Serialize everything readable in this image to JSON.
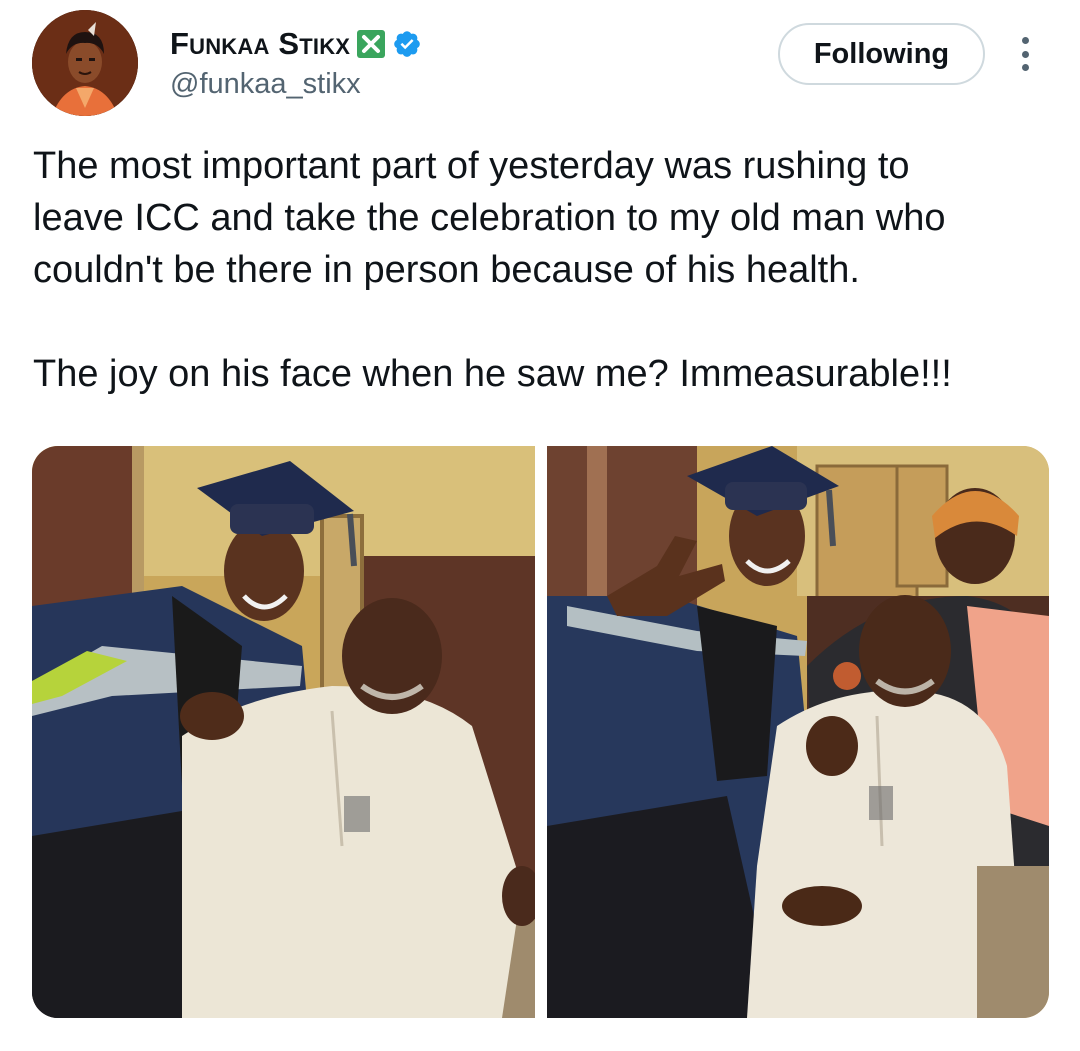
{
  "author": {
    "display_name": "Funkaa Stikx",
    "handle": "@funkaa_stikx",
    "avatar_icon": "illustrated-avatar",
    "badges": [
      "x-emoji-icon",
      "verified-badge-icon"
    ]
  },
  "actions": {
    "follow_label": "Following",
    "more_icon": "more-vertical-icon"
  },
  "tweet": {
    "lines_para1": [
      "The most important part of yesterday was rushing to",
      "leave ICC and take the celebration to my old man who",
      "couldn't be there in person because of his health."
    ],
    "lines_para2": [
      "The joy on his face when he saw me? Immeasurable!!!"
    ]
  },
  "colors": {
    "text": "#0f1419",
    "secondary_text": "#536471",
    "border": "#cfd9de",
    "verified_blue": "#1d9bf0",
    "x_badge_green": "#3aa55d"
  }
}
